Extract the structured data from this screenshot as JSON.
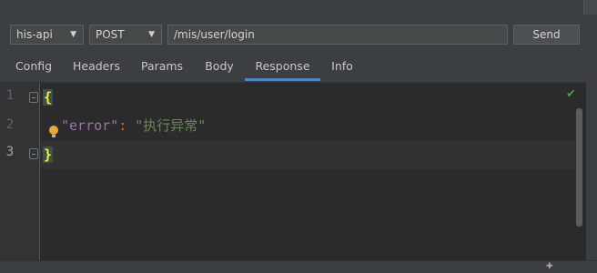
{
  "toolbar": {
    "environment": "his-api",
    "method": "POST",
    "url": "/mis/user/login",
    "send_label": "Send"
  },
  "tabs": [
    {
      "label": "Config"
    },
    {
      "label": "Headers"
    },
    {
      "label": "Params"
    },
    {
      "label": "Body"
    },
    {
      "label": "Response"
    },
    {
      "label": "Info"
    }
  ],
  "active_tab": "Response",
  "editor": {
    "line_numbers": [
      "1",
      "2",
      "3"
    ],
    "code": {
      "open_brace": "{",
      "key": "\"error\"",
      "colon": ":",
      "value": "\"执行异常\"",
      "close_brace": "}"
    }
  },
  "colors": {
    "accent": "#4a88c7",
    "background": "#2b2b2b",
    "key": "#9876aa",
    "string": "#6a8759",
    "brace": "#ffef28",
    "ok": "#499c54"
  },
  "icons": [
    "dropdown-arrow-icon",
    "bulb-icon",
    "checkmark-icon",
    "fold-icon"
  ]
}
